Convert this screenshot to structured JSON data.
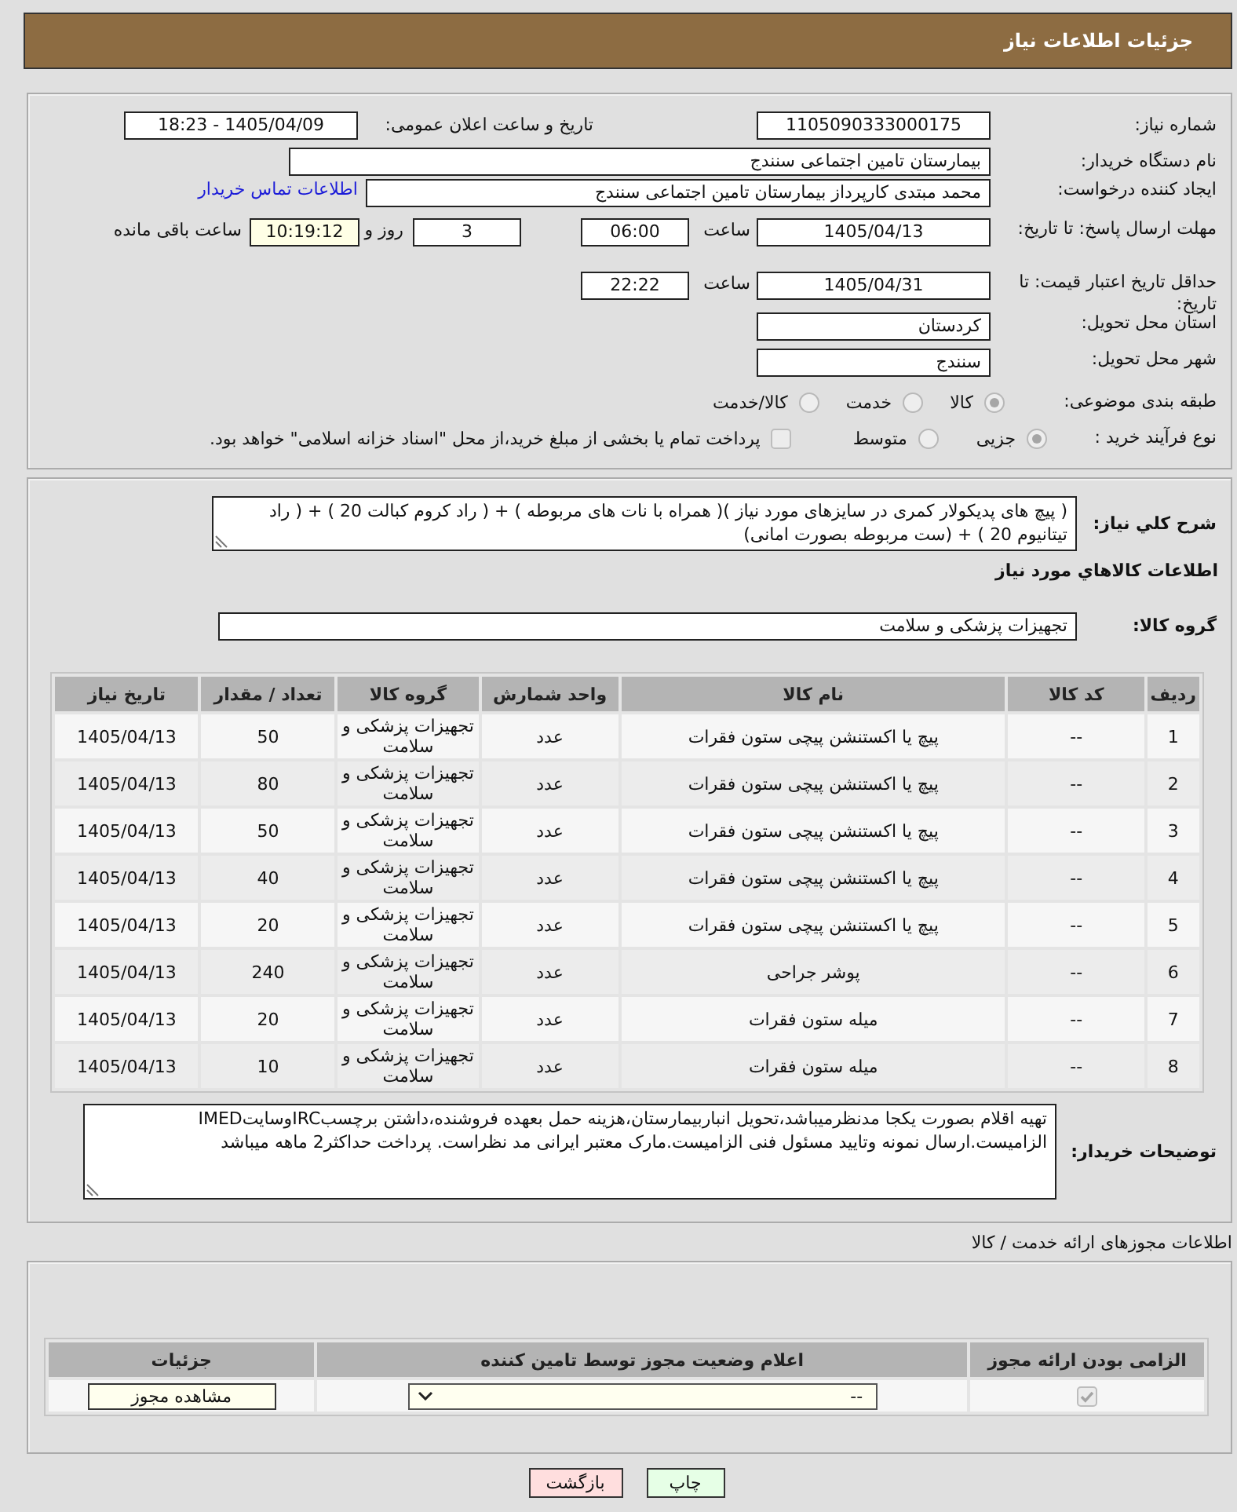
{
  "header": {
    "title": "جزئیات اطلاعات نیاز"
  },
  "details": {
    "need_number": {
      "label": "شماره نیاز:",
      "value": "1105090333000175"
    },
    "announcement": {
      "label": "تاریخ و ساعت اعلان عمومی:",
      "value": "1405/04/09 - 18:23"
    },
    "buyer_org": {
      "label": "نام دستگاه خریدار:",
      "value": "بیمارستان تامین اجتماعی سنندج"
    },
    "requester": {
      "label": "ایجاد کننده درخواست:",
      "value": "محمد مبتدی کارپرداز بیمارستان تامین اجتماعی سنندج",
      "contact_link": "اطلاعات تماس خریدار"
    },
    "response_deadline": {
      "label": "مهلت ارسال پاسخ: تا تاریخ:",
      "date": "1405/04/13",
      "time_label": "ساعت",
      "time": "06:00",
      "days": "3",
      "days_label": "روز و",
      "remaining": "10:19:12",
      "remaining_label": "ساعت باقی مانده"
    },
    "price_validity": {
      "label": "حداقل تاریخ اعتبار قیمت: تا تاریخ:",
      "date": "1405/04/31",
      "time_label": "ساعت",
      "time": "22:22"
    },
    "province": {
      "label": "استان محل تحویل:",
      "value": "کردستان"
    },
    "city": {
      "label": "شهر محل تحویل:",
      "value": "سنندج"
    },
    "category": {
      "label": "طبقه بندی موضوعی:",
      "options": [
        {
          "label": "کالا",
          "selected": true
        },
        {
          "label": "خدمت",
          "selected": false
        },
        {
          "label": "کالا/خدمت",
          "selected": false
        }
      ]
    },
    "purchase_type": {
      "label": "نوع فرآیند خرید :",
      "options": [
        {
          "label": "جزیی",
          "selected": true
        },
        {
          "label": "متوسط",
          "selected": false
        }
      ],
      "treasury_option": {
        "label": "پرداخت تمام یا بخشی از مبلغ خرید،از محل \"اسناد خزانه اسلامی\" خواهد بود.",
        "checked": false
      }
    }
  },
  "need": {
    "description_label": "شرح کلي نیاز:",
    "description": "( پیچ های پدیکولار کمری در سایزهای مورد نیاز )( همراه با نات های مربوطه ) + ( راد کروم کبالت 20 ) + ( راد تیتانیوم 20 ) + (ست مربوطه بصورت امانی)",
    "goods_heading": "اطلاعات کالاهاي مورد نیاز",
    "group_label": "گروه کالا:",
    "group": "تجهیزات پزشکی و سلامت"
  },
  "goods_table": {
    "columns": [
      "ردیف",
      "کد کالا",
      "نام کالا",
      "واحد شمارش",
      "گروه کالا",
      "تعداد / مقدار",
      "تاریخ نیاز"
    ],
    "rows": [
      {
        "row": "1",
        "code": "--",
        "name": "پیچ یا اکستنشن پیچی ستون فقرات",
        "unit": "عدد",
        "group": "تجهیزات پزشکی و سلامت",
        "quantity": "50",
        "date": "1405/04/13"
      },
      {
        "row": "2",
        "code": "--",
        "name": "پیچ یا اکستنشن پیچی ستون فقرات",
        "unit": "عدد",
        "group": "تجهیزات پزشکی و سلامت",
        "quantity": "80",
        "date": "1405/04/13"
      },
      {
        "row": "3",
        "code": "--",
        "name": "پیچ یا اکستنشن پیچی ستون فقرات",
        "unit": "عدد",
        "group": "تجهیزات پزشکی و سلامت",
        "quantity": "50",
        "date": "1405/04/13"
      },
      {
        "row": "4",
        "code": "--",
        "name": "پیچ یا اکستنشن پیچی ستون فقرات",
        "unit": "عدد",
        "group": "تجهیزات پزشکی و سلامت",
        "quantity": "40",
        "date": "1405/04/13"
      },
      {
        "row": "5",
        "code": "--",
        "name": "پیچ یا اکستنشن پیچی ستون فقرات",
        "unit": "عدد",
        "group": "تجهیزات پزشکی و سلامت",
        "quantity": "20",
        "date": "1405/04/13"
      },
      {
        "row": "6",
        "code": "--",
        "name": "پوشر جراحی",
        "unit": "عدد",
        "group": "تجهیزات پزشکی و سلامت",
        "quantity": "240",
        "date": "1405/04/13"
      },
      {
        "row": "7",
        "code": "--",
        "name": "میله ستون فقرات",
        "unit": "عدد",
        "group": "تجهیزات پزشکی و سلامت",
        "quantity": "20",
        "date": "1405/04/13"
      },
      {
        "row": "8",
        "code": "--",
        "name": "میله ستون فقرات",
        "unit": "عدد",
        "group": "تجهیزات پزشکی و سلامت",
        "quantity": "10",
        "date": "1405/04/13"
      }
    ]
  },
  "buyer_notes": {
    "label": "توضیحات خریدار:",
    "text": "تهیه اقلام بصورت یکجا مدنظرمیباشد،تحویل انباربیمارستان،هزینه حمل بعهده فروشنده،داشتن برچسبIRCوسایتIMED الزامیست.ارسال نمونه وتایید مسئول فنی الزامیست.مارک معتبر ایرانی مد نظراست. پرداخت حداکثر2 ماهه میباشد"
  },
  "permits": {
    "heading": "اطلاعات مجوزهای ارائه خدمت / کالا",
    "columns": [
      "الزامی بودن ارائه مجوز",
      "اعلام وضعیت مجوز توسط تامین کننده",
      "جزئیات"
    ],
    "rows": [
      {
        "required": true,
        "status": "--",
        "details_button": "مشاهده مجوز"
      }
    ]
  },
  "buttons": [
    {
      "kind": "print",
      "label": "چاپ"
    },
    {
      "kind": "back",
      "label": "بازگشت"
    }
  ]
}
